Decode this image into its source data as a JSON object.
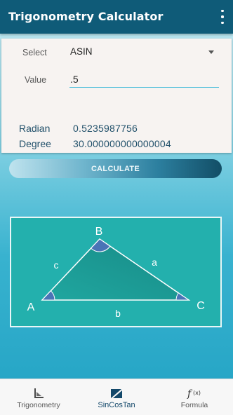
{
  "app_bar": {
    "title": "Trigonometry Calculator",
    "menu_icon": "more-vert-icon"
  },
  "form": {
    "select_label": "Select",
    "select_value": "ASIN",
    "value_label": "Value",
    "value_input": ".5"
  },
  "results": {
    "radian_label": "Radian",
    "radian_value": "0.5235987756",
    "degree_label": "Degree",
    "degree_value": "30.000000000000004"
  },
  "calculate_button": "CALCULATE",
  "triangle": {
    "vertex_a": "A",
    "vertex_b": "B",
    "vertex_c": "C",
    "side_a": "a",
    "side_b": "b",
    "side_c": "c"
  },
  "bottom_nav": {
    "active": "SinCosTan",
    "tabs": [
      {
        "label": "Trigonometry",
        "icon": "triangle-ruler-icon"
      },
      {
        "label": "SinCosTan",
        "icon": "sincostan-icon"
      },
      {
        "label": "Formula",
        "icon": "function-fx-icon"
      }
    ]
  },
  "colors": {
    "app_bar": "#0f5b78",
    "accent": "#32b6d6",
    "triangle_bg": "#23b0ad"
  }
}
